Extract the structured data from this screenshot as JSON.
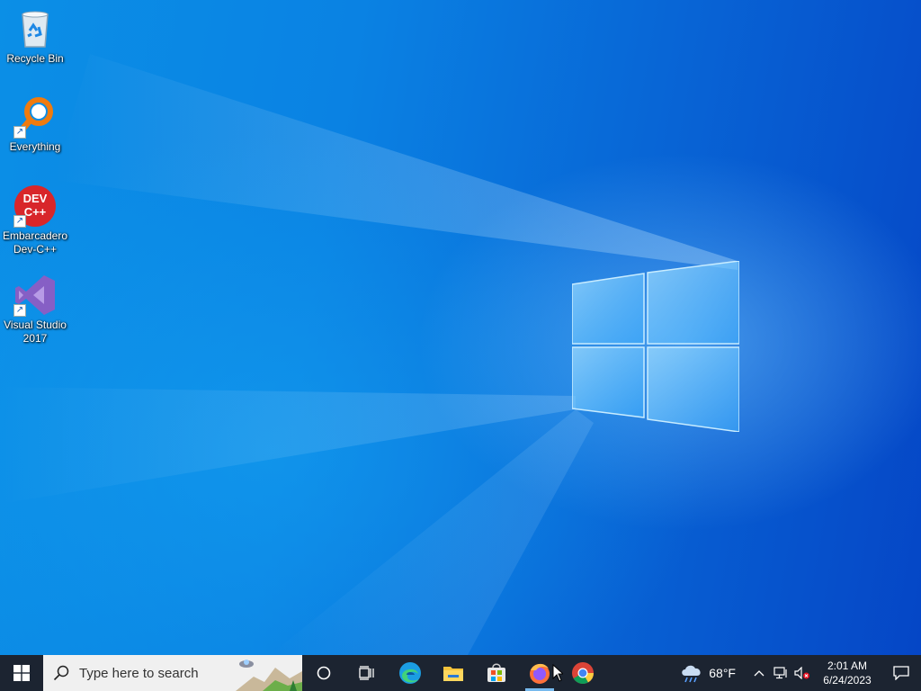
{
  "desktop": {
    "icons": [
      {
        "label": "Recycle Bin",
        "icon": "recycle-bin-icon"
      },
      {
        "label": "Everything",
        "icon": "everything-search-icon"
      },
      {
        "label": "Embarcadero Dev-C++",
        "icon": "devcpp-icon",
        "logo_text": "DEV C++"
      },
      {
        "label": "Visual Studio 2017",
        "icon": "visual-studio-icon"
      }
    ]
  },
  "taskbar": {
    "search_placeholder": "Type here to search",
    "apps": [
      {
        "name": "Microsoft Edge",
        "icon": "edge-icon"
      },
      {
        "name": "File Explorer",
        "icon": "folder-icon"
      },
      {
        "name": "Microsoft Store",
        "icon": "store-icon"
      },
      {
        "name": "Firefox",
        "icon": "firefox-icon",
        "active": true
      },
      {
        "name": "Google Chrome",
        "icon": "chrome-icon"
      }
    ],
    "weather": {
      "temp": "68°F",
      "icon": "cloud-rain-icon"
    },
    "clock": {
      "time": "2:01 AM",
      "date": "6/24/2023"
    }
  },
  "colors": {
    "taskbar_bg": "#1c2431",
    "wallpaper_blue": "#0a82e3",
    "active_indicator": "#76b9ed"
  }
}
